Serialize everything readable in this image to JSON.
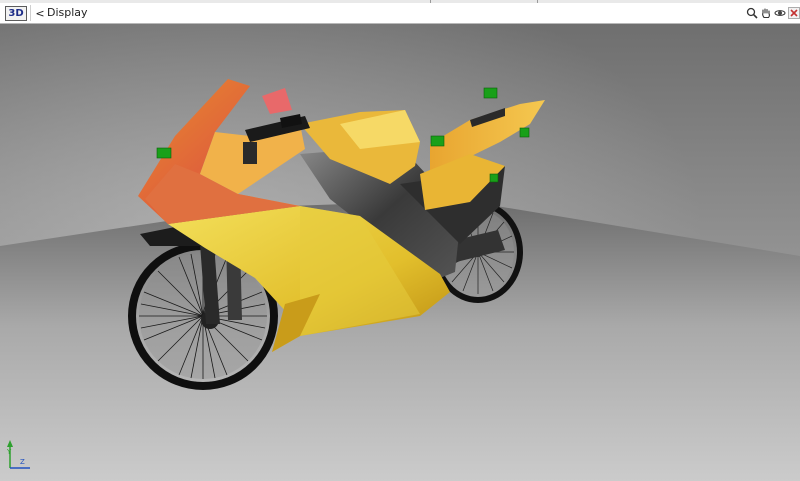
{
  "toolbar": {
    "view_mode_label": "3D",
    "back_label": "<",
    "panel_title": "Display",
    "tools": [
      {
        "name": "zoom-icon"
      },
      {
        "name": "pan-hand-icon"
      },
      {
        "name": "orbit-icon"
      },
      {
        "name": "close-icon"
      }
    ]
  },
  "viewport": {
    "axis_labels": {
      "y": "Y",
      "z": "Z"
    },
    "colors": {
      "background_wall": "#8f8f8f",
      "floor": "#b0b0b0",
      "body_yellow": "#e8c832",
      "body_orange": "#e07a30",
      "handle_green": "#1aa81a"
    }
  }
}
